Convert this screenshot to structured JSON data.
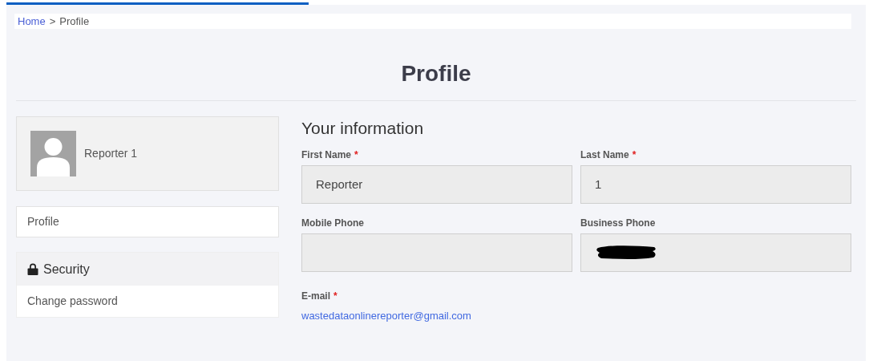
{
  "breadcrumb": [
    {
      "label": "Home",
      "link": true
    },
    {
      "label": ">",
      "link": false
    },
    {
      "label": "Profile",
      "link": false
    }
  ],
  "title": "Profile",
  "user_card": {
    "name": "Reporter 1"
  },
  "sidebar": {
    "profile_item": "Profile",
    "security": {
      "header": "Security",
      "items": [
        "Change password"
      ]
    }
  },
  "section_title": "Your information",
  "fields": [
    {
      "label": "First Name",
      "required_mark": "*",
      "kind": "text",
      "value": "Reporter"
    },
    {
      "label": "Last Name",
      "required_mark": "*",
      "kind": "text",
      "value": "1"
    },
    {
      "label": "Mobile Phone",
      "kind": "text"
    },
    {
      "label": "Business Phone",
      "kind": "redacted"
    }
  ],
  "email": {
    "label": "E-mail",
    "required_mark": "*",
    "value": "wastedataonlinereporter@gmail.com"
  }
}
